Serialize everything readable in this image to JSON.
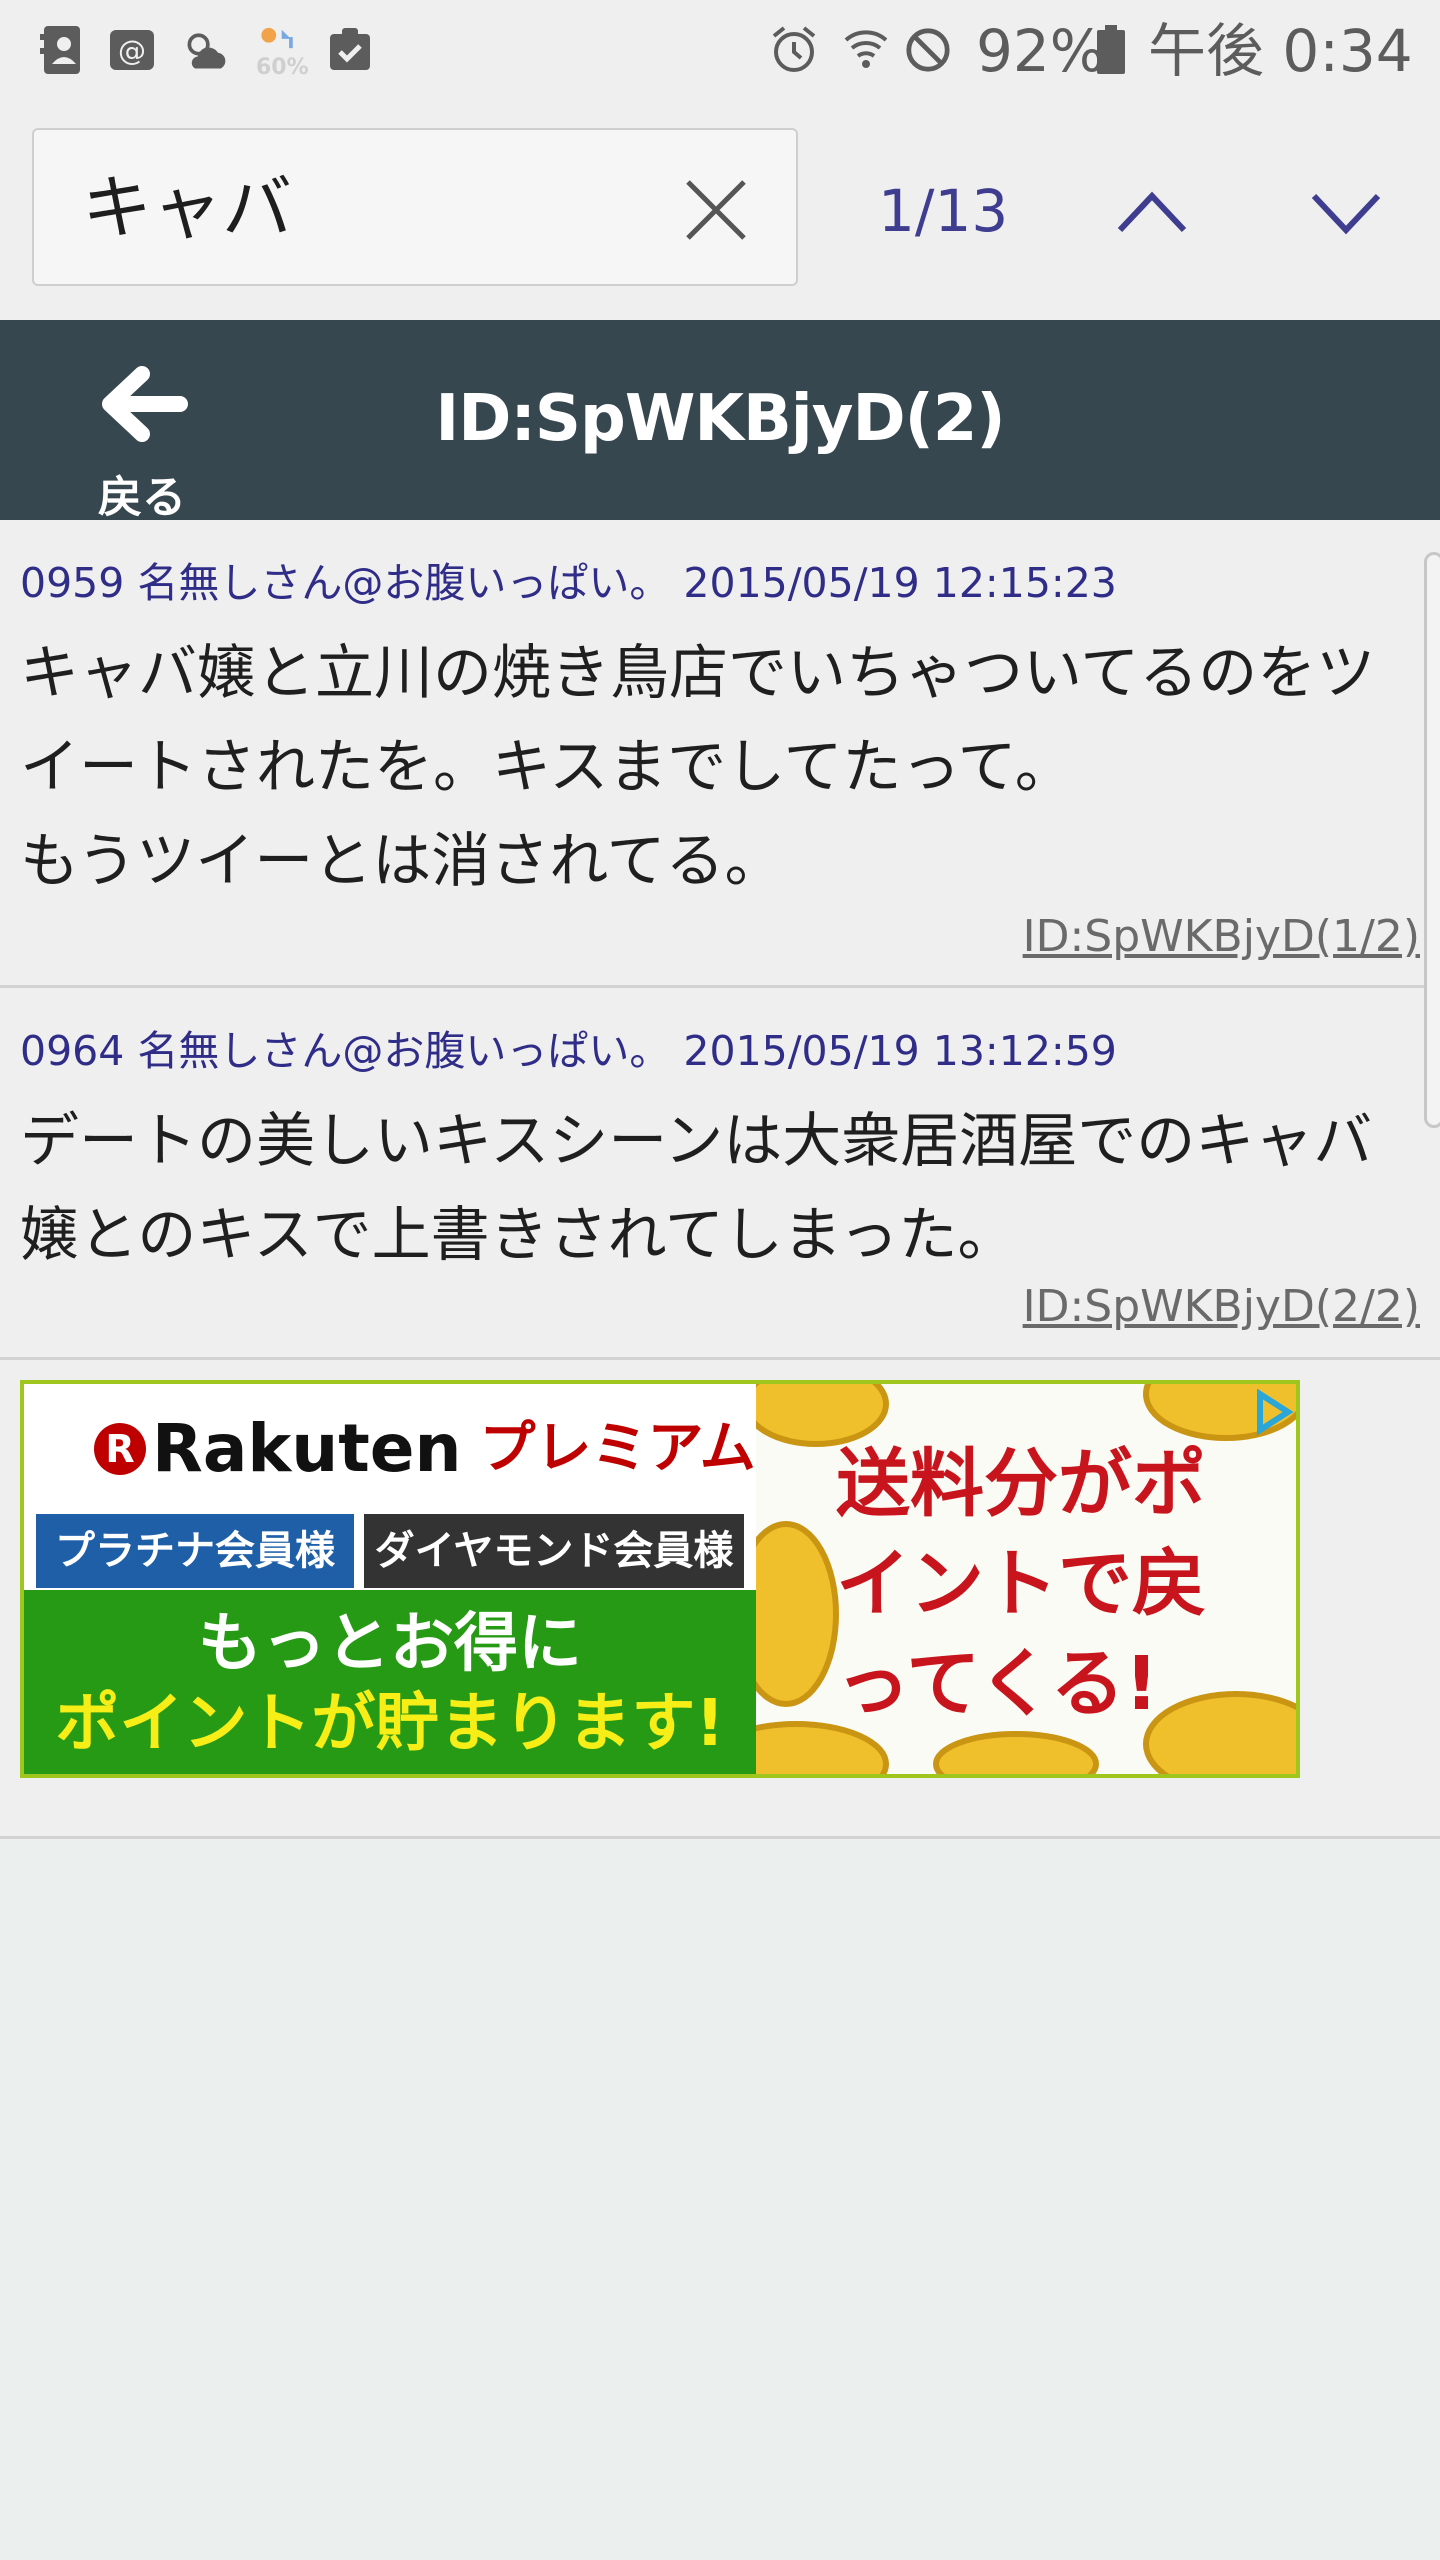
{
  "status_bar": {
    "battery_percent": "92%",
    "time": "午後 0:34",
    "weather_badge": "60%",
    "icons": [
      "contacts-icon",
      "email-icon",
      "weather-icon",
      "weather-alert-icon",
      "clipboard-check-icon",
      "alarm-icon",
      "wifi-icon",
      "do-not-disturb-icon",
      "battery-icon"
    ]
  },
  "search": {
    "query": "キャバ",
    "match_count": "1/13"
  },
  "header": {
    "back_label": "戻る",
    "title": "ID:SpWKBjyD(2)"
  },
  "posts": [
    {
      "meta": "0959 名無しさん@お腹いっぱい。 2015/05/19 12:15:23",
      "body": "キャバ嬢と立川の焼き鳥店でいちゃついてるのをツイートされたを。キスまでしてたって。\nもうツイーとは消されてる。",
      "id_link": "ID:SpWKBjyD(1/2)"
    },
    {
      "meta": "0964 名無しさん@お腹いっぱい。 2015/05/19 13:12:59",
      "body": "デートの美しいキスシーンは大衆居酒屋でのキャバ嬢とのキスで上書きされてしまった。",
      "id_link": "ID:SpWKBjyD(2/2)"
    }
  ],
  "ad": {
    "brand": "Rakuten",
    "premium": "プレミアム",
    "badge_platinum": "プラチナ会員様",
    "badge_diamond": "ダイヤモンド会員様",
    "line1": "もっとお得に",
    "line2": "ポイントが貯まります!",
    "right_text": "送料分がポイントで戻ってくる!",
    "colors": {
      "red": "#bf0000",
      "green": "#279a15",
      "yellow": "#f7ee18",
      "border": "#9ec61d"
    }
  },
  "colors": {
    "header_bg": "#37474f",
    "meta_text": "#2f2d88",
    "accent_nav": "#3f3d8f"
  }
}
